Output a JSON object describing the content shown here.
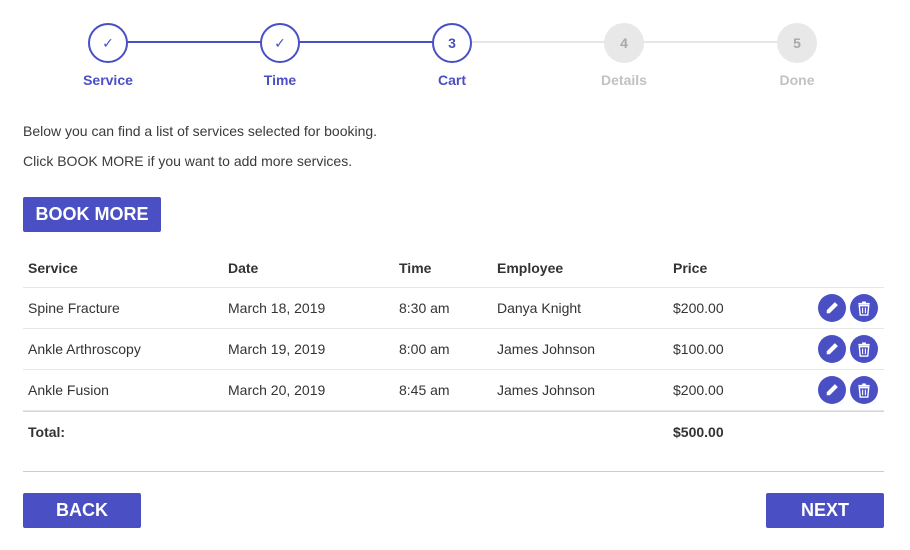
{
  "stepper": {
    "steps": [
      {
        "number": "✓",
        "label": "Service",
        "state": "completed"
      },
      {
        "number": "✓",
        "label": "Time",
        "state": "completed"
      },
      {
        "number": "3",
        "label": "Cart",
        "state": "active"
      },
      {
        "number": "4",
        "label": "Details",
        "state": "pending"
      },
      {
        "number": "5",
        "label": "Done",
        "state": "pending"
      }
    ]
  },
  "intro": {
    "line1": "Below you can find a list of services selected for booking.",
    "line2": "Click BOOK MORE if you want to add more services."
  },
  "buttons": {
    "book_more": "BOOK MORE",
    "back": "BACK",
    "next": "NEXT"
  },
  "table": {
    "headers": {
      "service": "Service",
      "date": "Date",
      "time": "Time",
      "employee": "Employee",
      "price": "Price"
    },
    "rows": [
      {
        "service": "Spine Fracture",
        "date": "March 18, 2019",
        "time": "8:30 am",
        "employee": "Danya Knight",
        "price": "$200.00"
      },
      {
        "service": "Ankle Arthroscopy",
        "date": "March 19, 2019",
        "time": "8:00 am",
        "employee": "James Johnson",
        "price": "$100.00"
      },
      {
        "service": "Ankle Fusion",
        "date": "March 20, 2019",
        "time": "8:45 am",
        "employee": "James Johnson",
        "price": "$200.00"
      }
    ],
    "total_label": "Total:",
    "total_value": "$500.00"
  },
  "icons": {
    "edit": "pencil-icon",
    "delete": "trash-icon"
  },
  "colors": {
    "accent": "#4a4fc4",
    "pending": "#e8e8e8",
    "pending_text": "#c2c2c2"
  }
}
